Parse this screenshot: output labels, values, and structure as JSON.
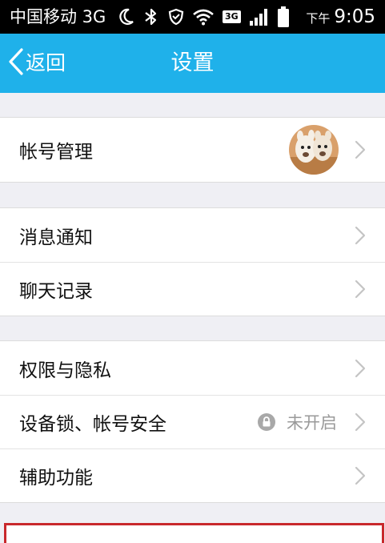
{
  "status_bar": {
    "carrier": "中国移动 3G",
    "network_badge": "3G",
    "ampm": "下午",
    "time": "9:05",
    "icons": [
      "moon-icon",
      "bluetooth-icon",
      "shield-icon",
      "wifi-icon",
      "3g-icon",
      "signal-icon",
      "battery-icon"
    ]
  },
  "header": {
    "back_label": "返回",
    "title": "设置",
    "background_color": "#1fb1ea"
  },
  "settings": {
    "account": {
      "label": "帐号管理"
    },
    "notifications": {
      "label": "消息通知"
    },
    "chat_history": {
      "label": "聊天记录"
    },
    "privacy": {
      "label": "权限与隐私"
    },
    "device_lock": {
      "label": "设备锁、帐号安全",
      "status": "未开启"
    },
    "accessibility": {
      "label": "辅助功能"
    }
  },
  "colors": {
    "accent": "#1fb1ea",
    "background": "#efeff4",
    "highlight": "#c8282c"
  }
}
